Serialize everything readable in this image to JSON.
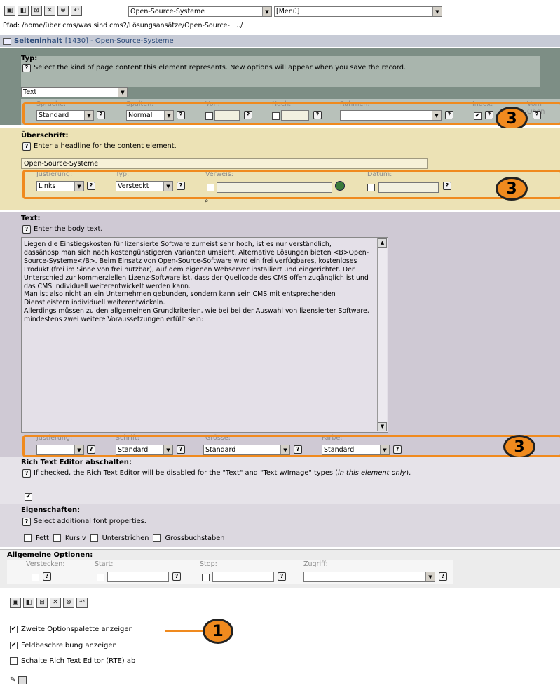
{
  "toolbar": {
    "buttons": [
      "save-icon",
      "save-view-icon",
      "save-close-icon",
      "close-icon",
      "delete-icon",
      "undo-icon"
    ],
    "page_select": "Open-Source-Systeme",
    "menu_select": "[Menü]"
  },
  "path": "Pfad: /home/über cms/was sind cms?/Lösungsansätze/Open-Source-...../",
  "header_bar": {
    "label": "Seiteninhalt",
    "rest": " [1430] - Open-Source-Systeme"
  },
  "typ": {
    "label": "Typ:",
    "desc": "Select the kind of page content this element represents. New options will appear when you save the record.",
    "value": "Text",
    "row_labels": [
      "Sprache:",
      "Spalten:",
      "Von:",
      "Nach:",
      "Rahmen:",
      "Index:",
      "Vom Oben"
    ],
    "sprache": "Standard",
    "spalten": "Normal",
    "rahmen": ""
  },
  "ueberschrift": {
    "label": "Überschrift:",
    "desc": "Enter a headline for the content element.",
    "value": "Open-Source-Systeme",
    "row_labels": [
      "Justierung:",
      "Typ:",
      "Verweis:",
      "Datum:"
    ],
    "justierung": "Links",
    "typ": "Versteckt"
  },
  "text": {
    "label": "Text:",
    "desc": "Enter the body text.",
    "body": "Liegen die Einstiegskosten für lizensierte Software zumeist sehr hoch, ist es nur verständlich, dassänbsp;man sich nach kostengünstigeren Varianten umsieht. Alternative Lösungen bieten <B>Open-Source-Systeme</B>. Beim Einsatz von Open-Source-Software wird ein frei verfügbares, kostenloses Produkt (frei im Sinne von frei nutzbar), auf dem eigenen Webserver installiert und eingerichtet. Der Unterschied zur kommerziellen Lizenz-Software ist, dass der Quellcode des CMS offen zugänglich ist und das CMS individuell weiterentwickelt werden kann.\nMan ist also nicht an ein Unternehmen gebunden, sondern kann sein CMS mit entsprechenden Dienstleistern individuell weiterentwickeln.\nAllerdings müssen zu den allgemeinen Grundkriterien, wie bei bei der Auswahl von lizensierter Software, mindestens zwei weitere Voraussetzungen erfüllt sein:",
    "row_labels": [
      "Justierung:",
      "Schrift:",
      "Grösse:",
      "Farbe:"
    ],
    "justierung": "",
    "schrift": "Standard",
    "groesse": "Standard",
    "farbe": "Standard"
  },
  "rte": {
    "label": "Rich Text Editor abschalten:",
    "desc": "If checked, the Rich Text Editor will be disabled for the \"Text\" and \"Text w/Image\" types (",
    "desc_em": "in this element only",
    "desc_end": ").",
    "checked": true
  },
  "eigenschaften": {
    "label": "Eigenschaften:",
    "desc": "Select additional font properties.",
    "options": [
      "Fett",
      "Kursiv",
      "Unterstrichen",
      "Grossbuchstaben"
    ]
  },
  "allgemein": {
    "label": "Allgemeine Optionen:",
    "row_labels": [
      "Verstecken:",
      "Start:",
      "Stop:",
      "Zugriff:"
    ],
    "zugriff": ""
  },
  "bottom": {
    "options": [
      {
        "label": "Zweite Optionspalette anzeigen",
        "checked": true
      },
      {
        "label": "Feldbeschreibung anzeigen",
        "checked": true
      },
      {
        "label": "Schalte Rich Text Editor (RTE) ab",
        "checked": false
      }
    ]
  },
  "callouts": [
    "3",
    "3",
    "3",
    "1"
  ],
  "help_glyph": "?",
  "colors": {
    "accent": "#f08a1e",
    "typ_bg": "#7d8e85",
    "ueb_bg": "#ece2b5",
    "text_bg": "#cfc9d4",
    "header_bg": "#c7cbd6"
  }
}
